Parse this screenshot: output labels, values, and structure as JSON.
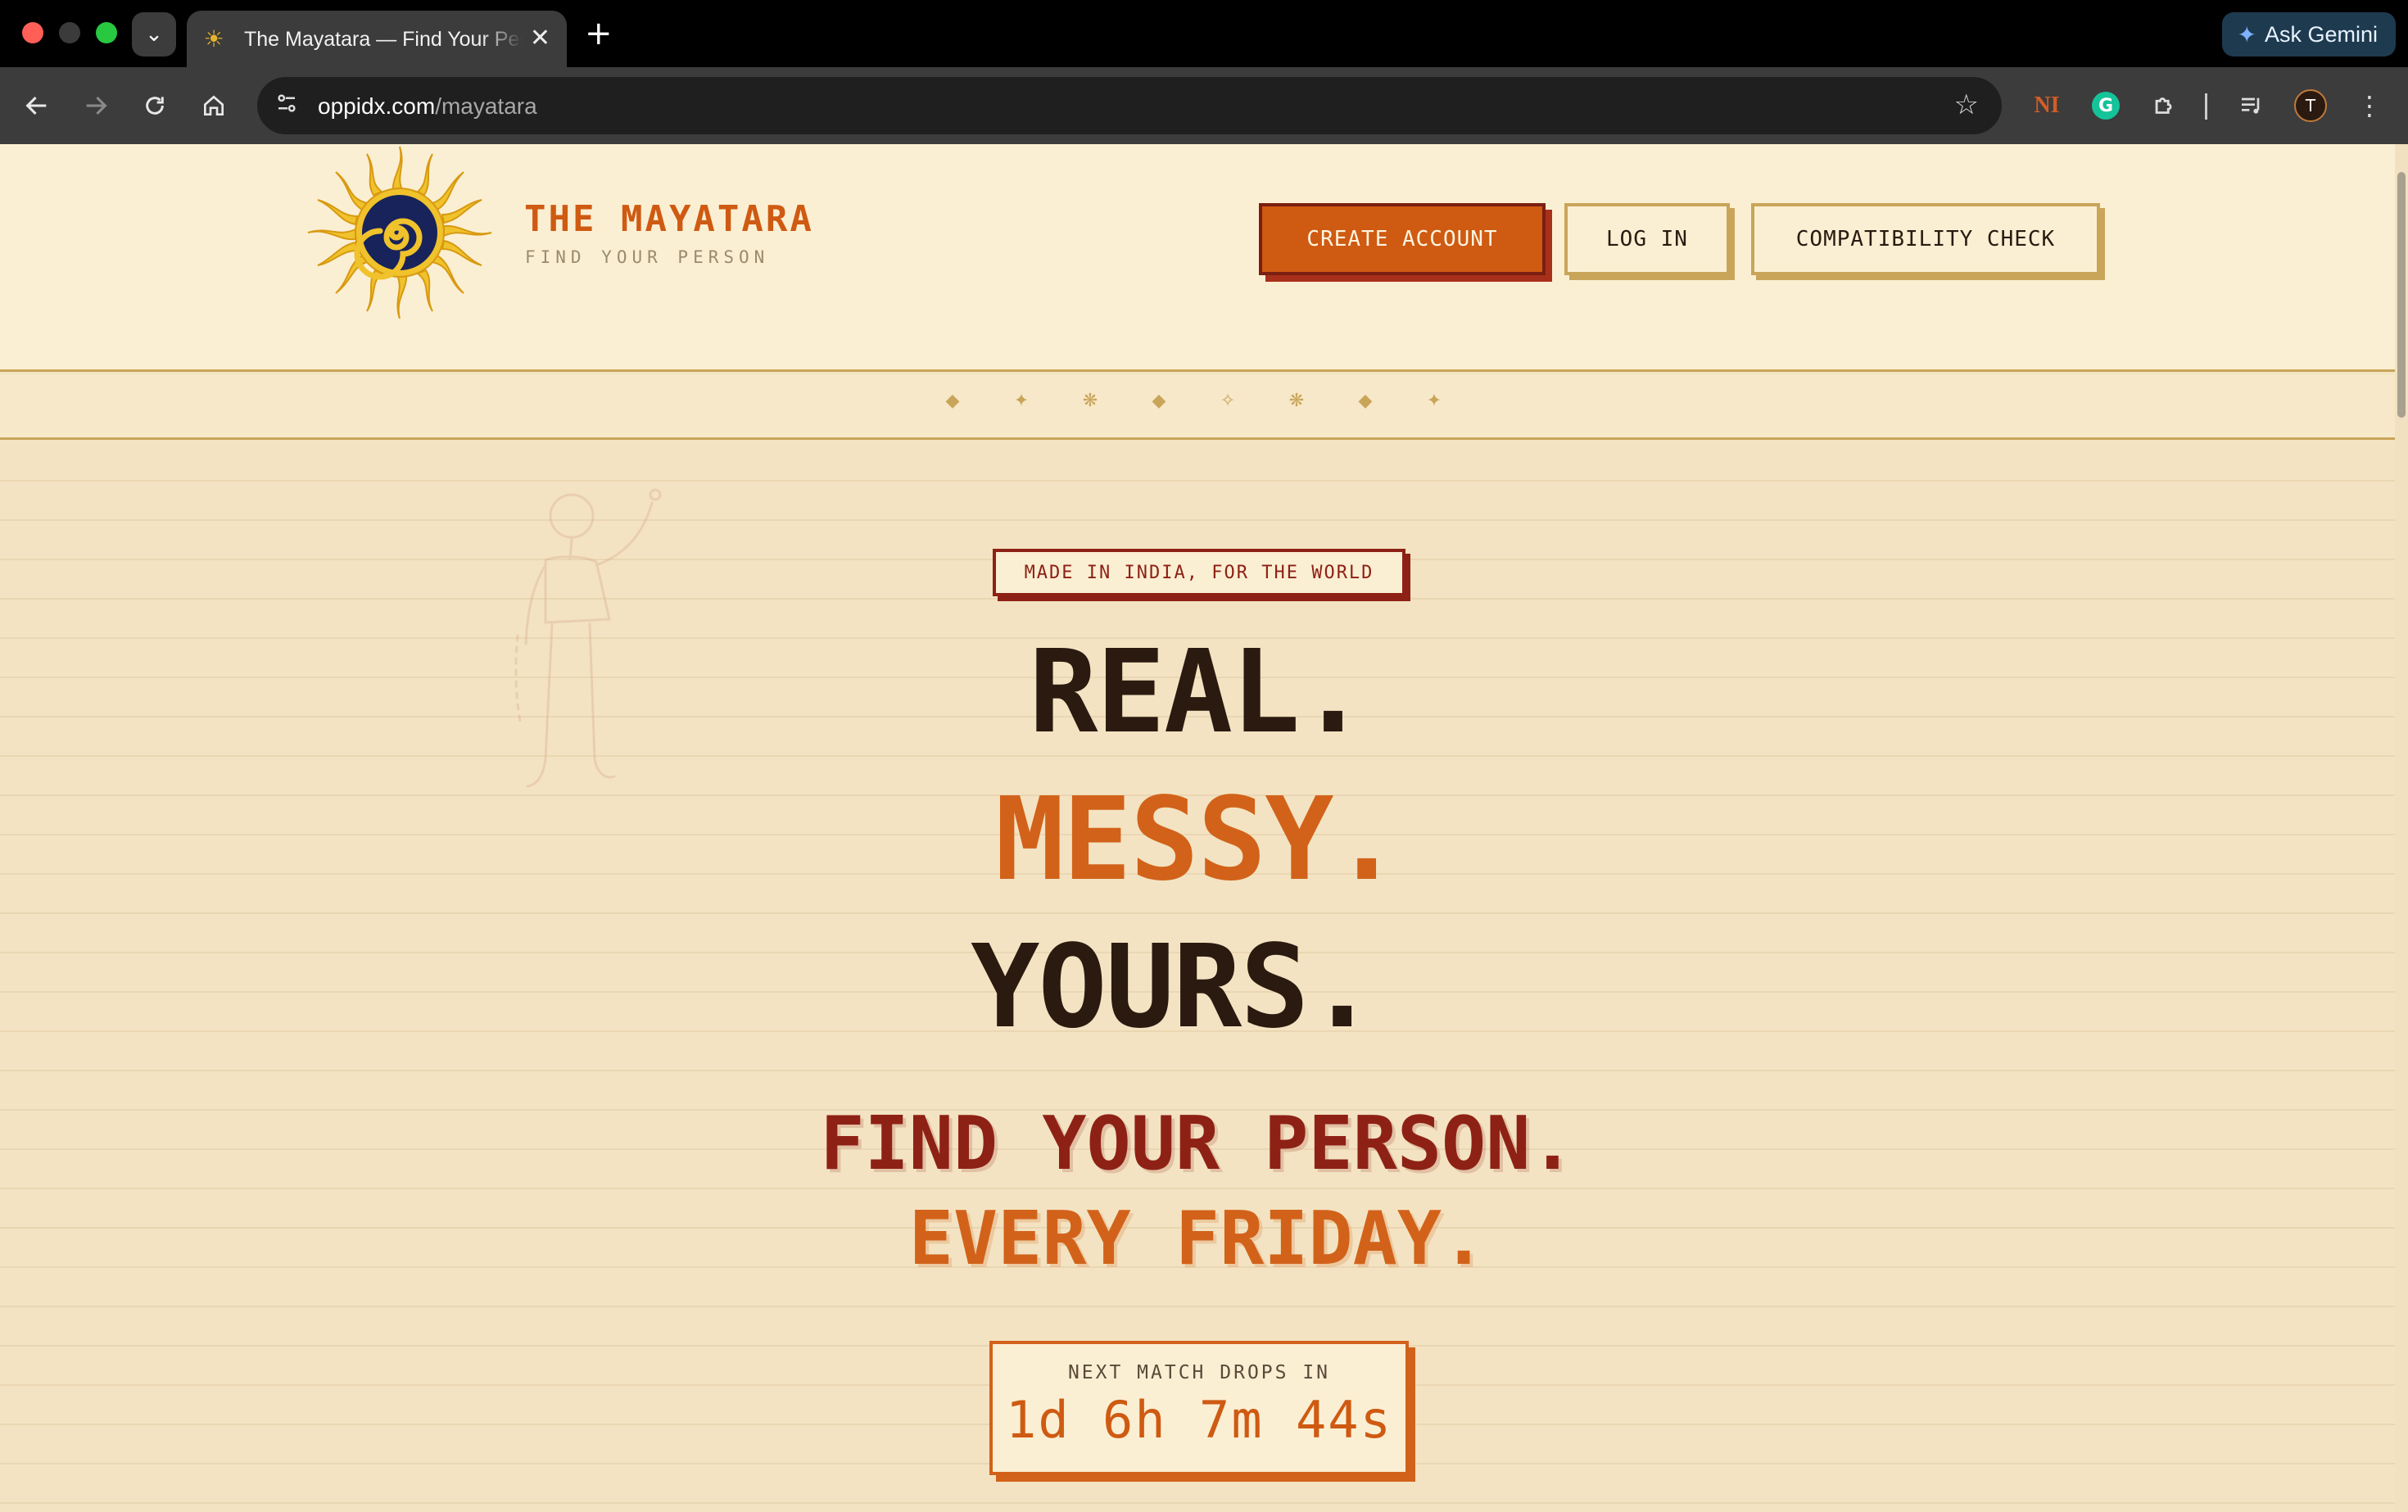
{
  "browser": {
    "tab_title": "The Mayatara — Find Your Person",
    "tab_close": "✕",
    "new_tab": "+",
    "ask_gemini": "Ask Gemini",
    "url_host": "oppidx.com",
    "url_path": "/mayatara",
    "icons": [
      "back-icon",
      "forward-icon",
      "reload-icon",
      "home-icon",
      "site-info-icon",
      "bookmark-star-icon",
      "extension-icon",
      "media-icon",
      "profile-avatar",
      "more-menu-icon"
    ],
    "avatar_letter": "T",
    "ext_ni_label": "NI",
    "ext_g_label": "G"
  },
  "header": {
    "brand_name": "THE MAYATARA",
    "brand_tagline": "FIND YOUR PERSON",
    "buttons": {
      "create_account": "CREATE ACCOUNT",
      "log_in": "LOG IN",
      "compatibility_check": "COMPATIBILITY CHECK"
    }
  },
  "ornaments": [
    "◆",
    "✦",
    "❋",
    "◆",
    "✧",
    "❋",
    "◆",
    "✦"
  ],
  "hero": {
    "badge": "MADE IN INDIA, FOR THE WORLD",
    "line1": "REAL",
    "line2": "MESSY",
    "line3": "YOURS",
    "dot": ".",
    "sub1": "FIND YOUR PERSON.",
    "sub2": "EVERY FRIDAY."
  },
  "countdown": {
    "label": "NEXT MATCH DROPS IN",
    "value": "1d 6h 7m 44s"
  },
  "colors": {
    "accent_orange": "#cf5a12",
    "deep_red": "#8e2115",
    "ink": "#2a1a10",
    "gold": "#c9a55a",
    "paper": "#f3e3c2"
  }
}
